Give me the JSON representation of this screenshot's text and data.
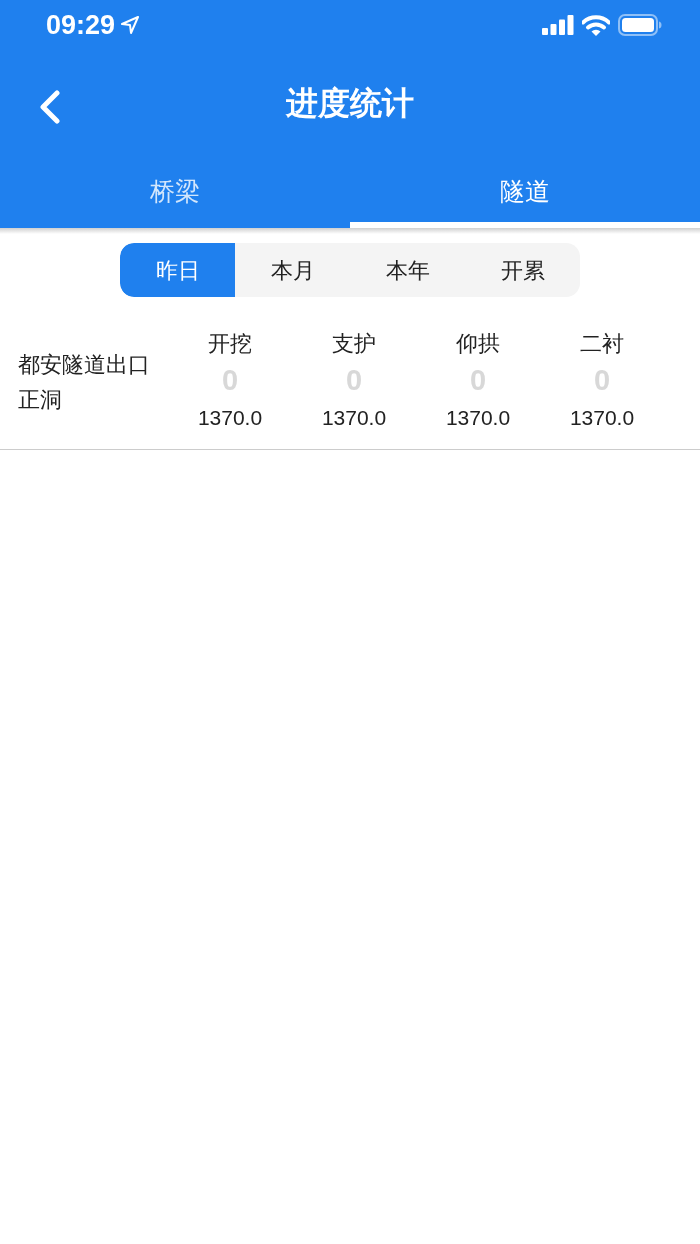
{
  "status_bar": {
    "time": "09:29"
  },
  "nav": {
    "title": "进度统计"
  },
  "tabs": [
    {
      "label": "桥梁",
      "selected": false
    },
    {
      "label": "隧道",
      "selected": true
    }
  ],
  "periods": [
    {
      "label": "昨日",
      "selected": true
    },
    {
      "label": "本月",
      "selected": false
    },
    {
      "label": "本年",
      "selected": false
    },
    {
      "label": "开累",
      "selected": false
    }
  ],
  "rows": [
    {
      "name": "都安隧道出口正洞",
      "metrics": [
        {
          "label": "开挖",
          "value": "0",
          "total": "1370.0"
        },
        {
          "label": "支护",
          "value": "0",
          "total": "1370.0"
        },
        {
          "label": "仰拱",
          "value": "0",
          "total": "1370.0"
        },
        {
          "label": "二衬",
          "value": "0",
          "total": "1370.0"
        }
      ]
    }
  ]
}
